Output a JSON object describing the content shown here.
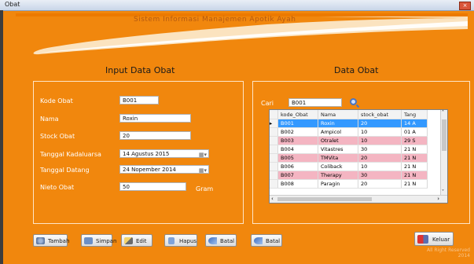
{
  "window": {
    "title": "Obat",
    "close_glyph": "×"
  },
  "banner": {
    "text": "Sistem Informasi Manajemen Apotik Ayah"
  },
  "left_panel": {
    "heading": "Input Data Obat",
    "fields": {
      "kode": {
        "label": "Kode Obat",
        "value": "B001"
      },
      "nama": {
        "label": "Nama",
        "value": "Roxin"
      },
      "stock": {
        "label": "Stock Obat",
        "value": "20"
      },
      "kadaluarsa": {
        "label": "Tanggal Kadaluarsa",
        "value": "14  Agustus  2015"
      },
      "datang": {
        "label": "Tanggal Datang",
        "value": "24 Nopember  2014"
      },
      "netto": {
        "label": "Nieto Obat",
        "value": "50",
        "unit": "Gram"
      }
    }
  },
  "right_panel": {
    "heading": "Data Obat",
    "search": {
      "label": "Cari",
      "value": "B001",
      "icon": "search-icon"
    },
    "table": {
      "columns": [
        "kode_Obat",
        "Nama",
        "stock_obat",
        "Tang"
      ],
      "rows": [
        [
          "B001",
          "Roxin",
          "20",
          "14 A"
        ],
        [
          "B002",
          "Ampicol",
          "10",
          "01 A"
        ],
        [
          "B003",
          "Otralet",
          "10",
          "29 S"
        ],
        [
          "B004",
          "Vitastres",
          "30",
          "21 N"
        ],
        [
          "B005",
          "TMVita",
          "20",
          "21 N"
        ],
        [
          "B006",
          "Coliback",
          "10",
          "21 N"
        ],
        [
          "B007",
          "Therapy",
          "30",
          "21 N"
        ],
        [
          "B008",
          "Paragin",
          "20",
          "21 N"
        ]
      ],
      "scroll_arrows": {
        "up": "˄",
        "down": "˅",
        "left": "‹",
        "right": "›"
      }
    }
  },
  "buttons": {
    "tambah": "Tambah",
    "simpan": "Simpan",
    "edit": "Edit",
    "hapus": "Hapus",
    "batal1": "Batal",
    "batal2": "Batal",
    "keluar": "Keluar"
  },
  "footer": {
    "line1": "All Right Reserved",
    "line2": "2014"
  },
  "colors": {
    "background": "#f1870d",
    "selected_row": "#3399ff",
    "pink_row": "#f4b5c2"
  }
}
